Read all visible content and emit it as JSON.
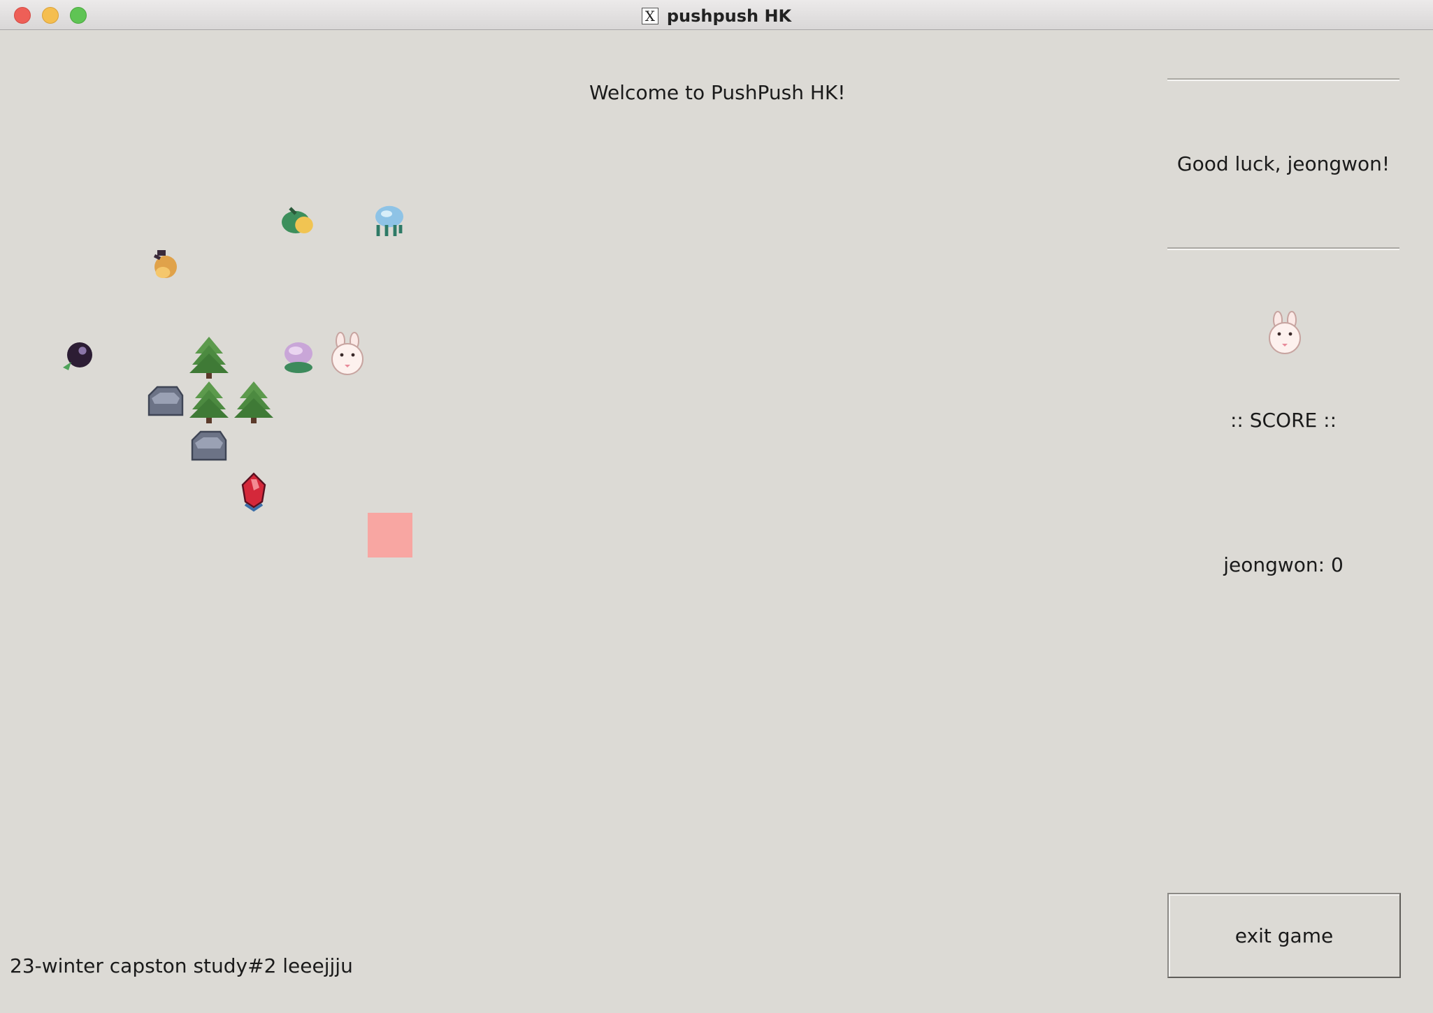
{
  "window": {
    "title": "pushpush HK",
    "x_logo": "X"
  },
  "main": {
    "welcome": "Welcome to PushPush HK!"
  },
  "sidebar": {
    "greeting": "Good luck, jeongwon!",
    "score_heading": ":: SCORE ::",
    "player_name": "jeongwon",
    "player_score": "jeongwon: 0",
    "exit_label": "exit game"
  },
  "footer": {
    "credit": "23-winter capston study#2 leeejjju"
  },
  "board_items": [
    {
      "name": "green-fruit-icon",
      "kind": "fruit-green"
    },
    {
      "name": "blue-jelly-icon",
      "kind": "jelly"
    },
    {
      "name": "honey-pot-icon",
      "kind": "honey"
    },
    {
      "name": "dark-berry-icon",
      "kind": "berry"
    },
    {
      "name": "pine-tree-icon",
      "kind": "tree"
    },
    {
      "name": "pink-cake-icon",
      "kind": "cake"
    },
    {
      "name": "bunny-player-icon",
      "kind": "bunny"
    },
    {
      "name": "rock-icon",
      "kind": "rock"
    },
    {
      "name": "pine-tree-icon",
      "kind": "tree"
    },
    {
      "name": "pine-tree-icon",
      "kind": "tree"
    },
    {
      "name": "rock-icon",
      "kind": "rock"
    },
    {
      "name": "red-gem-icon",
      "kind": "gem"
    },
    {
      "name": "goal-tile",
      "kind": "goal"
    }
  ],
  "colors": {
    "background": "#dcdad5",
    "goal": "#f8a6a2",
    "tree": "#5c9a4c",
    "rock": "#6c7386"
  }
}
